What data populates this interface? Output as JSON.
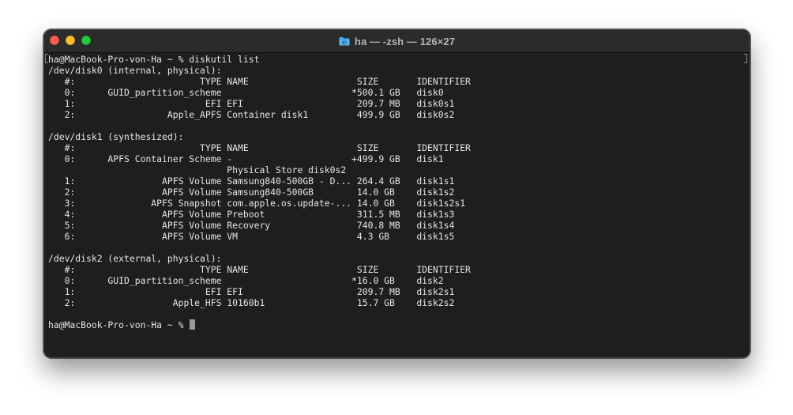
{
  "window": {
    "title": "ha — -zsh — 126×27"
  },
  "terminal": {
    "lines": [
      "ha@MacBook-Pro-von-Ha ~ % diskutil list",
      "/dev/disk0 (internal, physical):",
      "   #:                       TYPE NAME                    SIZE       IDENTIFIER",
      "   0:      GUID_partition_scheme                        *500.1 GB   disk0",
      "   1:                        EFI EFI                     209.7 MB   disk0s1",
      "   2:                 Apple_APFS Container disk1         499.9 GB   disk0s2",
      "",
      "/dev/disk1 (synthesized):",
      "   #:                       TYPE NAME                    SIZE       IDENTIFIER",
      "   0:      APFS Container Scheme -                      +499.9 GB   disk1",
      "                                 Physical Store disk0s2",
      "   1:                APFS Volume Samsung840-500GB - D... 264.4 GB   disk1s1",
      "   2:                APFS Volume Samsung840-500GB        14.0 GB    disk1s2",
      "   3:              APFS Snapshot com.apple.os.update-... 14.0 GB    disk1s2s1",
      "   4:                APFS Volume Preboot                 311.5 MB   disk1s3",
      "   5:                APFS Volume Recovery                740.8 MB   disk1s4",
      "   6:                APFS Volume VM                      4.3 GB     disk1s5",
      "",
      "/dev/disk2 (external, physical):",
      "   #:                       TYPE NAME                    SIZE       IDENTIFIER",
      "   0:      GUID_partition_scheme                        *16.0 GB    disk2",
      "   1:                        EFI EFI                     209.7 MB   disk2s1",
      "   2:                  Apple_HFS 10160b1                 15.7 GB    disk2s2",
      "",
      "ha@MacBook-Pro-von-Ha ~ % "
    ]
  },
  "icons": {
    "folder": "folder-icon"
  },
  "colors": {
    "background": "#1e1e1e",
    "text": "#e6e6e6",
    "titlebar": "#2b2b2b",
    "close": "#ff5f57",
    "minimize": "#febc2e",
    "zoom": "#28c840",
    "folder": "#3fa4e6"
  }
}
